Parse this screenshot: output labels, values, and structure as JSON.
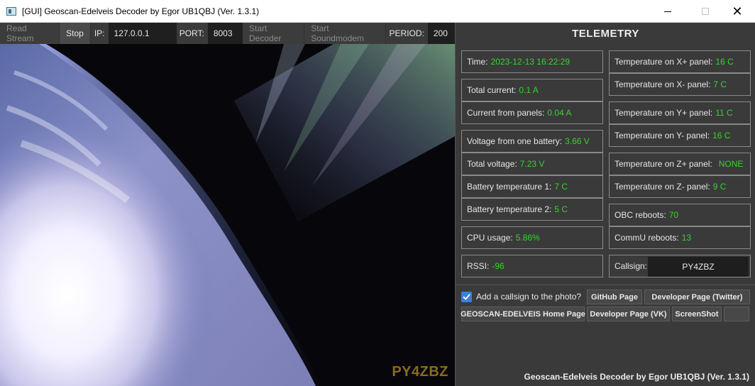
{
  "window": {
    "title": "[GUI] Geoscan-Edelveis Decoder by Egor UB1QBJ (Ver. 1.3.1)",
    "minimize_icon": "minimize-icon",
    "maximize_icon": "maximize-icon",
    "close_glyph": "✕"
  },
  "toolbar": {
    "read_stream": "Read Stream",
    "stop": "Stop",
    "ip_label": "IP:",
    "ip_value": "127.0.0.1",
    "port_label": "PORT:",
    "port_value": "8003",
    "start_decoder": "Start Decoder",
    "start_soundmodem": "Start Soundmodem",
    "period_label": "PERIOD:",
    "period_value": "200"
  },
  "photo": {
    "overlay_callsign": "PY4ZBZ"
  },
  "telemetry": {
    "title": "TELEMETRY",
    "time_label": "Time:",
    "time_value": "2023-12-13 16:22:29",
    "total_current_label": "Total current:",
    "total_current_value": "0.1 A",
    "current_panels_label": "Current from panels:",
    "current_panels_value": "0.04 A",
    "voltage_battery_label": "Voltage from one battery:",
    "voltage_battery_value": "3.66 V",
    "total_voltage_label": "Total voltage:",
    "total_voltage_value": "7.23 V",
    "battery_temp1_label": "Battery temperature 1:",
    "battery_temp1_value": "7 C",
    "battery_temp2_label": "Battery temperature 2:",
    "battery_temp2_value": "5 C",
    "cpu_label": "CPU usage:",
    "cpu_value": "5.86%",
    "rssi_label": "RSSI:",
    "rssi_value": "-96",
    "temp_xp_label": "Temperature on X+ panel:",
    "temp_xp_value": "16 C",
    "temp_xm_label": "Temperature on X- panel:",
    "temp_xm_value": "7 C",
    "temp_yp_label": "Temperature on Y+ panel:",
    "temp_yp_value": "11 C",
    "temp_ym_label": "Temperature on Y- panel:",
    "temp_ym_value": "16 C",
    "temp_zp_label": "Temperature on Z+ panel:",
    "temp_zp_value": "NONE",
    "temp_zm_label": "Temperature on Z- panel:",
    "temp_zm_value": "9 C",
    "obc_label": "OBC reboots:",
    "obc_value": "70",
    "commu_label": "CommU reboots:",
    "commu_value": "13",
    "callsign_label": "Callsign:",
    "callsign_value": "PY4ZBZ"
  },
  "controls": {
    "add_callsign_label": "Add a callsign to the photo?",
    "add_callsign_checked": true,
    "github_page": "GitHub Page",
    "dev_twitter": "Developer Page (Twitter)",
    "home_page": "GEOSCAN-EDELVEIS Home Page",
    "dev_vk": "Developer Page (VK)",
    "screenshot": "ScreenShot",
    "blank_button": ""
  },
  "footer": "Geoscan-Edelveis Decoder by Egor UB1QBJ (Ver. 1.3.1)",
  "colors": {
    "value_green": "#35d42e",
    "panel_bg": "#3a3a3a",
    "checkbox_blue": "#3c7fd6",
    "callsign_overlay": "#8b6a1e"
  }
}
